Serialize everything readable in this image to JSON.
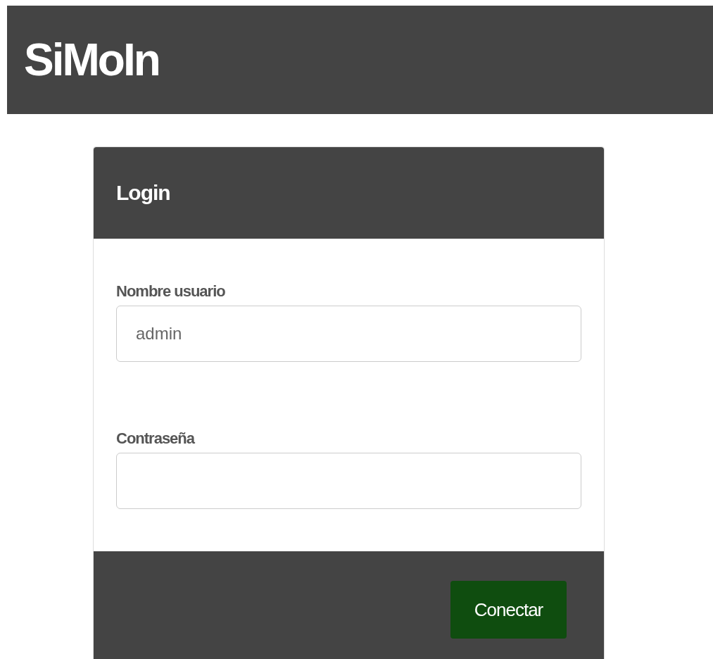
{
  "header": {
    "title": "SiMoIn"
  },
  "login_card": {
    "title": "Login",
    "fields": [
      {
        "label": "Nombre usuario",
        "value": "admin"
      },
      {
        "label": "Contraseña"
      }
    ],
    "submit_button": "Conectar"
  }
}
